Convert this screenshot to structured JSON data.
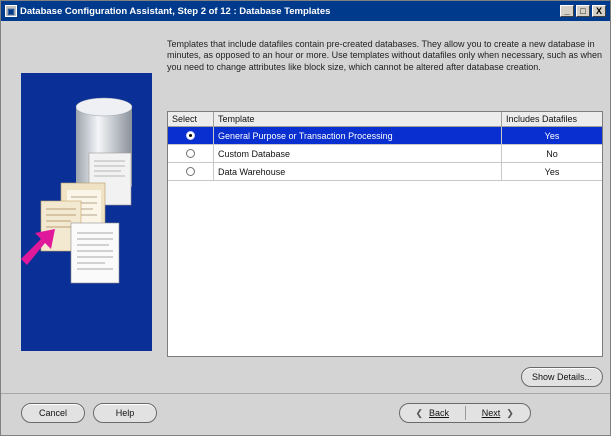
{
  "window": {
    "title": "Database Configuration Assistant, Step 2 of 12 : Database Templates",
    "buttons": [
      "_",
      "□",
      "X"
    ]
  },
  "description": "Templates that include datafiles contain pre-created databases. They allow you to create a new database in minutes, as opposed to an hour or more. Use templates without datafiles only when necessary, such as when you need to change attributes like block size, which cannot be altered after database creation.",
  "table": {
    "columns": [
      "Select",
      "Template",
      "Includes Datafiles"
    ],
    "rows": [
      {
        "template": "General Purpose or Transaction Processing",
        "includes": "Yes",
        "selected": true
      },
      {
        "template": "Custom Database",
        "includes": "No",
        "selected": false
      },
      {
        "template": "Data Warehouse",
        "includes": "Yes",
        "selected": false
      }
    ]
  },
  "buttons": {
    "show_details": "Show Details...",
    "cancel": "Cancel",
    "help": "Help",
    "back": "Back",
    "next": "Next"
  },
  "colors": {
    "titlebar": "#003a8c",
    "art_background": "#0a2f96",
    "selection": "#0a2fd0"
  }
}
